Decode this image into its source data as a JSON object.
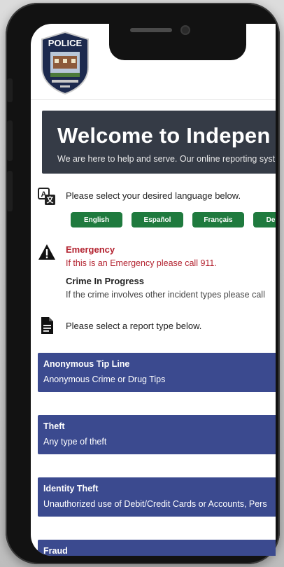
{
  "logo": {
    "text": "POLICE"
  },
  "banner": {
    "title": "Welcome to Indepen",
    "subtitle": "We are here to help and serve. Our online reporting syst"
  },
  "language": {
    "prompt": "Please select your desired language below.",
    "buttons": [
      "English",
      "Español",
      "Français",
      "De"
    ]
  },
  "emergency": {
    "title": "Emergency",
    "text": "If this is an Emergency please call 911."
  },
  "crime_in_progress": {
    "title": "Crime In Progress",
    "text": "If the crime involves other incident types please call"
  },
  "report": {
    "prompt": "Please select a report type below.",
    "cards": [
      {
        "title": "Anonymous Tip Line",
        "desc": "Anonymous Crime or Drug Tips"
      },
      {
        "title": "Theft",
        "desc": "Any type of theft"
      },
      {
        "title": "Identity Theft",
        "desc": "Unauthorized use of Debit/Credit Cards or Accounts, Pers"
      },
      {
        "title": "Fraud",
        "desc": ""
      }
    ]
  },
  "colors": {
    "banner": "#353b46",
    "language_button": "#1f7a3e",
    "emergency": "#b3222f",
    "card": "#3b4a8f"
  }
}
